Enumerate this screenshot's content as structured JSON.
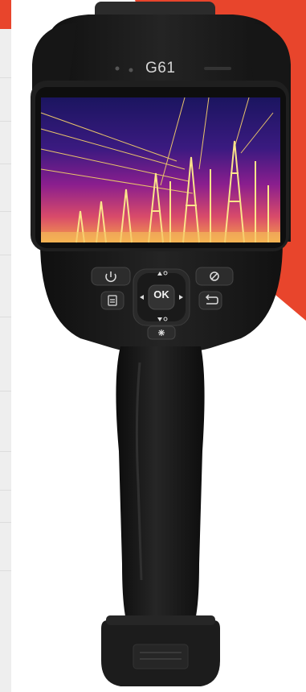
{
  "device": {
    "model_label": "G61",
    "ok_label": "OK",
    "body_color": "#1a1a1a",
    "accent_color": "#e8452c"
  },
  "buttons": [
    {
      "name": "power-button",
      "icon": "power-icon"
    },
    {
      "name": "manual-focus-button",
      "icon": "slash-circle-icon"
    },
    {
      "name": "file-button",
      "icon": "document-icon"
    },
    {
      "name": "back-button",
      "icon": "return-arrow-icon"
    },
    {
      "name": "laser-button",
      "icon": "star-burst-icon"
    },
    {
      "name": "dpad-up",
      "icon": "up-triangle-bulb-icon"
    },
    {
      "name": "dpad-down",
      "icon": "down-triangle-zoom-icon"
    },
    {
      "name": "dpad-left",
      "icon": "left-triangle-icon"
    },
    {
      "name": "dpad-right",
      "icon": "right-triangle-icon"
    }
  ]
}
